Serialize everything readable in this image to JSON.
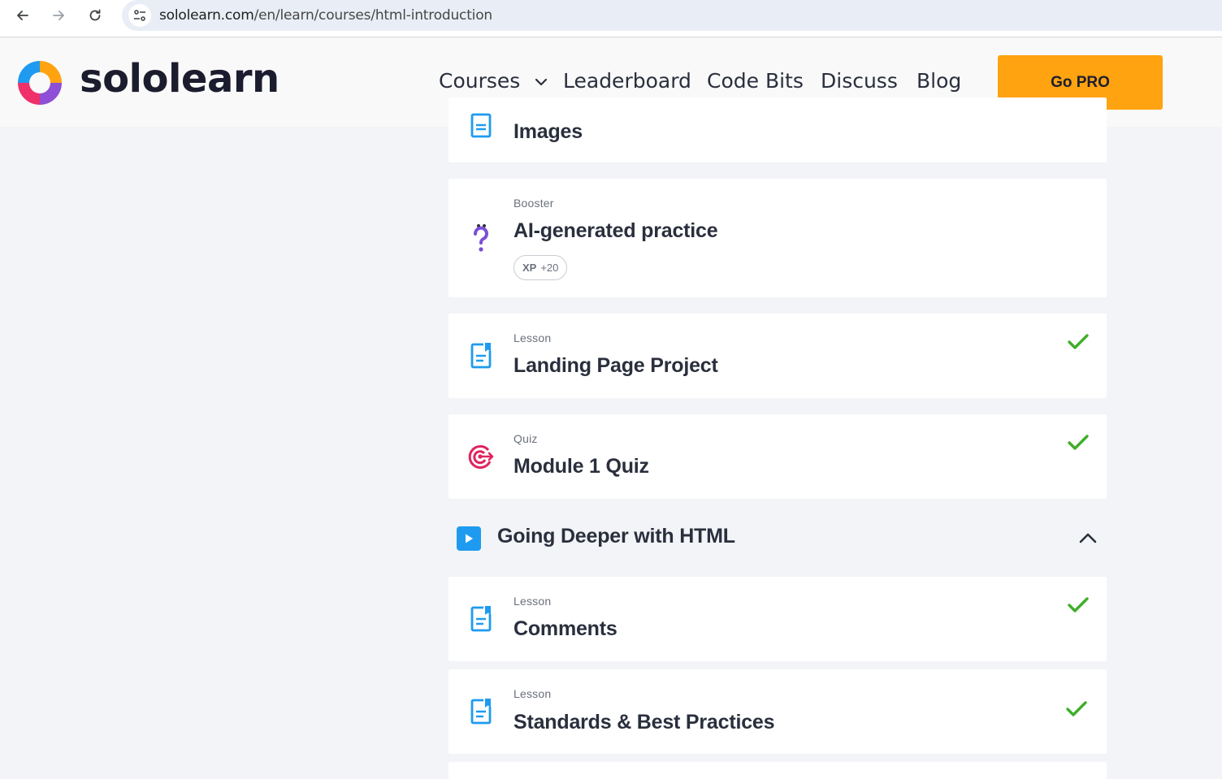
{
  "browser": {
    "url_host": "sololearn.com",
    "url_path": "/en/learn/courses/html-introduction",
    "icons": [
      "back-arrow-icon",
      "forward-arrow-icon",
      "reload-icon",
      "site-info-icon"
    ]
  },
  "header": {
    "brand": "sololearn",
    "nav": {
      "courses": "Courses",
      "leaderboard": "Leaderboard",
      "code_bits": "Code Bits",
      "discuss": "Discuss",
      "blog": "Blog"
    },
    "go_pro": "Go PRO",
    "colors": {
      "go_pro_bg": "#ffa310",
      "text": "#2a2f3d"
    }
  },
  "items": [
    {
      "kind": "",
      "title": "Images",
      "icon": "lesson-doc-icon",
      "completed": false
    },
    {
      "kind": "Booster",
      "title": "AI-generated practice",
      "icon": "question-mark-icon",
      "xp_label": "XP",
      "xp_value": "+20",
      "completed": false
    },
    {
      "kind": "Lesson",
      "title": "Landing Page Project",
      "icon": "lesson-doc-icon",
      "completed": true
    },
    {
      "kind": "Quiz",
      "title": "Module 1 Quiz",
      "icon": "target-icon",
      "completed": true
    }
  ],
  "section": {
    "title": "Going Deeper with HTML",
    "icon": "play-icon",
    "expanded": true
  },
  "section_items": [
    {
      "kind": "Lesson",
      "title": "Comments",
      "icon": "lesson-doc-icon",
      "completed": true
    },
    {
      "kind": "Lesson",
      "title": "Standards & Best Practices",
      "icon": "lesson-doc-icon",
      "completed": true
    }
  ],
  "accent_colors": {
    "lesson_icon": "#1e9bf0",
    "check": "#3fae29",
    "quiz_icon": "#e0245e",
    "booster_icon": "#7b4fd6"
  }
}
